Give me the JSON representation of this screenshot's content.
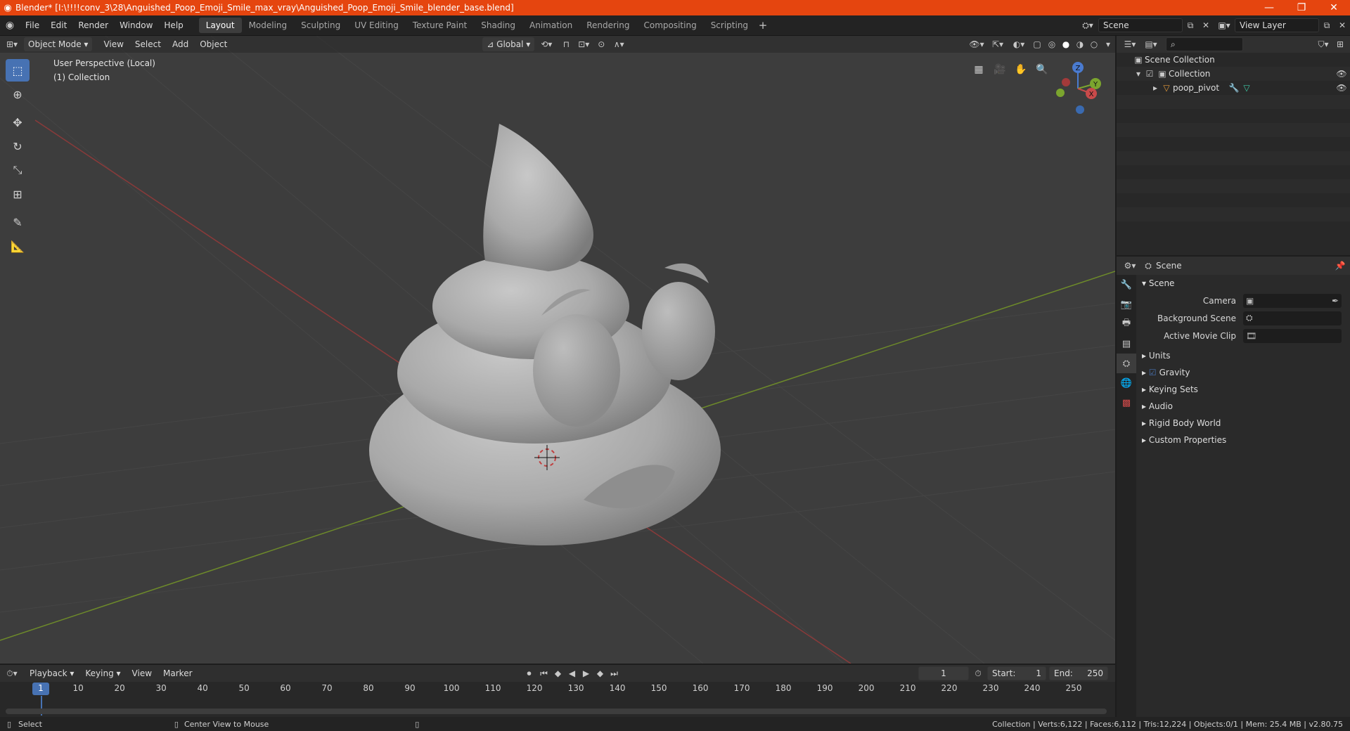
{
  "window": {
    "title": "Blender* [I:\\!!!!conv_3\\28\\Anguished_Poop_Emoji_Smile_max_vray\\Anguished_Poop_Emoji_Smile_blender_base.blend]",
    "controls": [
      "—",
      "❐",
      "✕"
    ]
  },
  "menu": [
    "File",
    "Edit",
    "Render",
    "Window",
    "Help"
  ],
  "workspaces": [
    "Layout",
    "Modeling",
    "Sculpting",
    "UV Editing",
    "Texture Paint",
    "Shading",
    "Animation",
    "Rendering",
    "Compositing",
    "Scripting"
  ],
  "scene_selector": {
    "value": "Scene"
  },
  "view_layer_selector": {
    "value": "View Layer"
  },
  "viewport": {
    "mode": "Object Mode",
    "menus": [
      "View",
      "Select",
      "Add",
      "Object"
    ],
    "orientation": "Global",
    "perspective_label": "User Perspective (Local)",
    "collection_label": "(1) Collection",
    "gizmo": {
      "x": "X",
      "y": "Y",
      "z": "Z"
    }
  },
  "outliner": {
    "search_placeholder": "",
    "rows": [
      {
        "label": "Scene Collection"
      },
      {
        "label": "Collection"
      },
      {
        "label": "poop_pivot"
      }
    ]
  },
  "properties": {
    "header_title": "Scene",
    "panel_title": "Scene",
    "camera_label": "Camera",
    "background_scene_label": "Background Scene",
    "active_movie_clip_label": "Active Movie Clip",
    "subpanels": [
      "Units",
      "Gravity",
      "Keying Sets",
      "Audio",
      "Rigid Body World",
      "Custom Properties"
    ],
    "gravity_checked": true
  },
  "timeline": {
    "menus": [
      "Playback",
      "Keying",
      "View",
      "Marker"
    ],
    "current_frame": "1",
    "start_label": "Start:",
    "start_value": "1",
    "end_label": "End:",
    "end_value": "250",
    "ticks": [
      "1",
      "10",
      "20",
      "30",
      "40",
      "50",
      "60",
      "70",
      "80",
      "90",
      "100",
      "110",
      "120",
      "130",
      "140",
      "150",
      "160",
      "170",
      "180",
      "190",
      "200",
      "210",
      "220",
      "230",
      "240",
      "250"
    ]
  },
  "status": {
    "left_action": "Select",
    "middle_action": "Center View to Mouse",
    "stats": "Collection | Verts:6,122 | Faces:6,112 | Tris:12,224 | Objects:0/1 | Mem: 25.4 MB | v2.80.75"
  },
  "colors": {
    "title_bar": "#e5450f",
    "accent": "#4772b3",
    "viewport_bg": "#3d3d3d"
  }
}
